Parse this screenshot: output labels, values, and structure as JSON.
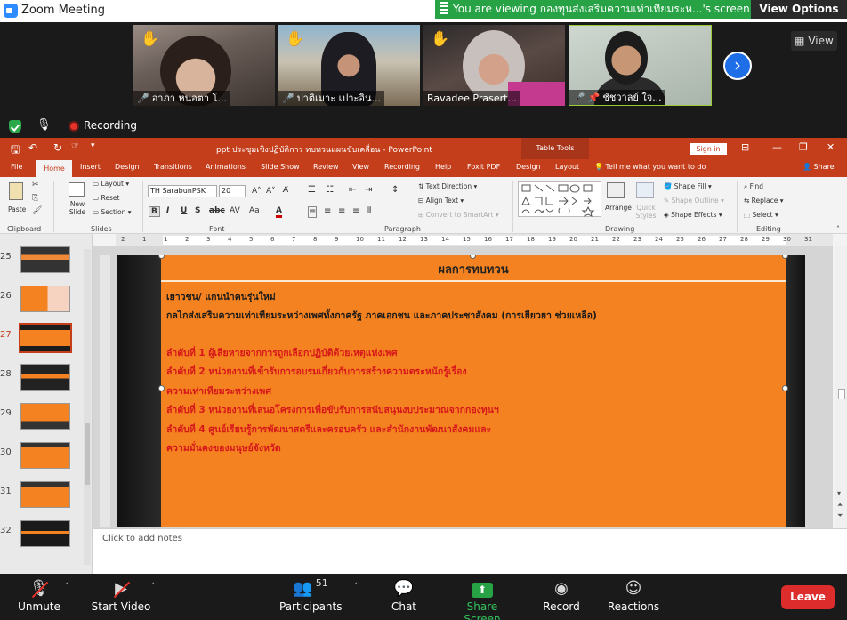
{
  "zoom": {
    "window_title": "Zoom Meeting",
    "viewing_banner": "You are viewing กองทุนส่งเสริมความเท่าเทียมระห...'s screen",
    "view_options": "View Options",
    "view_button": "View",
    "recording": "Recording",
    "participants_count": "51",
    "tiles": [
      {
        "name": "อาภา หน่อตา โ..."
      },
      {
        "name": "ปาติเมาะ เปาะอิน..."
      },
      {
        "name": "Ravadee Prasert..."
      },
      {
        "name": "ชัชวาลย์ ใจ..."
      }
    ],
    "toolbar": {
      "unmute": "Unmute",
      "start_video": "Start Video",
      "participants": "Participants",
      "chat": "Chat",
      "share_screen": "Share Screen",
      "record": "Record",
      "reactions": "Reactions",
      "leave": "Leave"
    }
  },
  "ppt": {
    "doc_title": "ppt ประชุมเชิงปฏิบัติการ ทบทวนแผนขับเคลื่อน - PowerPoint",
    "table_tools": "Table Tools",
    "sign_in": "Sign in",
    "share": "Share",
    "tell_me": "Tell me what you want to do",
    "tabs": [
      "File",
      "Home",
      "Insert",
      "Design",
      "Transitions",
      "Animations",
      "Slide Show",
      "Review",
      "View",
      "Recording",
      "Help",
      "Foxit PDF",
      "Design",
      "Layout"
    ],
    "ribbon": {
      "paste": "Paste",
      "clipboard": "Clipboard",
      "new_slide": "New Slide",
      "layout": "Layout",
      "reset": "Reset",
      "section": "Section",
      "slides": "Slides",
      "font_name": "TH SarabunPSK",
      "font_size": "20",
      "font": "Font",
      "text_direction": "Text Direction",
      "align_text": "Align Text",
      "convert_smartart": "Convert to SmartArt",
      "paragraph": "Paragraph",
      "arrange": "Arrange",
      "quick_styles": "Quick Styles",
      "shape_fill": "Shape Fill",
      "shape_outline": "Shape Outline",
      "shape_effects": "Shape Effects",
      "drawing": "Drawing",
      "find": "Find",
      "replace": "Replace",
      "select": "Select",
      "editing": "Editing"
    },
    "thumbnails": [
      "25",
      "26",
      "27",
      "28",
      "29",
      "30",
      "31",
      "32"
    ],
    "active_thumbnail": "27",
    "ruler_numbers": [
      "2",
      "1",
      "1",
      "2",
      "3",
      "4",
      "5",
      "6",
      "7",
      "8",
      "9",
      "10",
      "11",
      "12",
      "13",
      "14",
      "15",
      "16",
      "17",
      "18",
      "19",
      "20",
      "21",
      "22",
      "23",
      "24",
      "25",
      "26",
      "27",
      "28",
      "29",
      "30",
      "31"
    ],
    "slide": {
      "title": "ผลการทบทวน",
      "lines": [
        {
          "text": "เยาวชน/ แกนนำคนรุ่นใหม่",
          "color": "black"
        },
        {
          "text": "กลไกส่งเสริมความเท่าเทียมระหว่างเพศทั้งภาครัฐ ภาคเอกชน และภาคประชาสังคม (การเยียวยา ช่วยเหลือ)",
          "color": "black"
        },
        {
          "text": "ลำดับที่ 1 ผู้เสียหายจากการถูกเลือกปฏิบัติด้วยเหตุแห่งเพศ",
          "color": "red"
        },
        {
          "text": "ลำดับที่ 2 หน่วยงานที่เข้ารับการอบรมเกี่ยวกับการสร้างความตระหนักรู้เรื่อง",
          "color": "red"
        },
        {
          "text": "ความเท่าเทียมระหว่างเพศ",
          "color": "red"
        },
        {
          "text": "ลำดับที่ 3 หน่วยงานที่เสนอโครงการเพื่อขับรับการสนับสนุนงบประมาณจากกองทุนฯ",
          "color": "red"
        },
        {
          "text": "ลำดับที่ 4 ศูนย์เรียนรู้การพัฒนาสตรีและครอบครัว และสำนักงานพัฒนาสังคมและ",
          "color": "red"
        },
        {
          "text": "ความมั่นคงของมนุษย์จังหวัด",
          "color": "red"
        }
      ]
    },
    "notes_placeholder": "Click to add notes"
  },
  "colors": {
    "ppt_accent": "#c43e1c",
    "slide_orange": "#f58220",
    "zoom_green": "#27a244",
    "leave_red": "#dd2c2c",
    "text_red": "#d6181b"
  }
}
